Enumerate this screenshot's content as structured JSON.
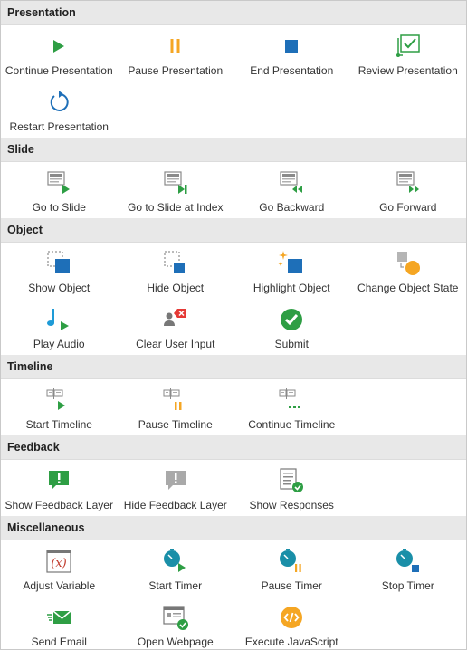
{
  "sections": [
    {
      "title": "Presentation",
      "items": [
        {
          "label": "Continue Presentation",
          "icon": "play-icon"
        },
        {
          "label": "Pause Presentation",
          "icon": "pause-icon"
        },
        {
          "label": "End Presentation",
          "icon": "stop-icon"
        },
        {
          "label": "Review Presentation",
          "icon": "review-icon"
        },
        {
          "label": "Restart Presentation",
          "icon": "restart-icon"
        }
      ]
    },
    {
      "title": "Slide",
      "items": [
        {
          "label": "Go to Slide",
          "icon": "slide-play-icon"
        },
        {
          "label": "Go to Slide at Index",
          "icon": "slide-index-icon"
        },
        {
          "label": "Go Backward",
          "icon": "slide-backward-icon"
        },
        {
          "label": "Go Forward",
          "icon": "slide-forward-icon"
        }
      ]
    },
    {
      "title": "Object",
      "items": [
        {
          "label": "Show Object",
          "icon": "show-object-icon"
        },
        {
          "label": "Hide Object",
          "icon": "hide-object-icon"
        },
        {
          "label": "Highlight Object",
          "icon": "highlight-object-icon"
        },
        {
          "label": "Change Object State",
          "icon": "change-state-icon"
        },
        {
          "label": "Play Audio",
          "icon": "audio-icon"
        },
        {
          "label": "Clear User Input",
          "icon": "clear-input-icon"
        },
        {
          "label": "Submit",
          "icon": "submit-icon"
        }
      ]
    },
    {
      "title": "Timeline",
      "items": [
        {
          "label": "Start Timeline",
          "icon": "timeline-start-icon"
        },
        {
          "label": "Pause Timeline",
          "icon": "timeline-pause-icon"
        },
        {
          "label": "Continue Timeline",
          "icon": "timeline-continue-icon"
        }
      ]
    },
    {
      "title": "Feedback",
      "items": [
        {
          "label": "Show Feedback Layer",
          "icon": "feedback-show-icon"
        },
        {
          "label": "Hide Feedback Layer",
          "icon": "feedback-hide-icon"
        },
        {
          "label": "Show Responses",
          "icon": "responses-icon"
        }
      ]
    },
    {
      "title": "Miscellaneous",
      "items": [
        {
          "label": "Adjust Variable",
          "icon": "variable-icon"
        },
        {
          "label": "Start Timer",
          "icon": "timer-start-icon"
        },
        {
          "label": "Pause Timer",
          "icon": "timer-pause-icon"
        },
        {
          "label": "Stop Timer",
          "icon": "timer-stop-icon"
        },
        {
          "label": "Send Email",
          "icon": "email-icon"
        },
        {
          "label": "Open Webpage",
          "icon": "webpage-icon"
        },
        {
          "label": "Execute JavaScript",
          "icon": "javascript-icon"
        }
      ]
    }
  ],
  "colors": {
    "green": "#2e9e44",
    "orange": "#f5a623",
    "blue": "#1e6fb8",
    "gray": "#8a8a8a",
    "header_bg": "#e8e8e8"
  }
}
